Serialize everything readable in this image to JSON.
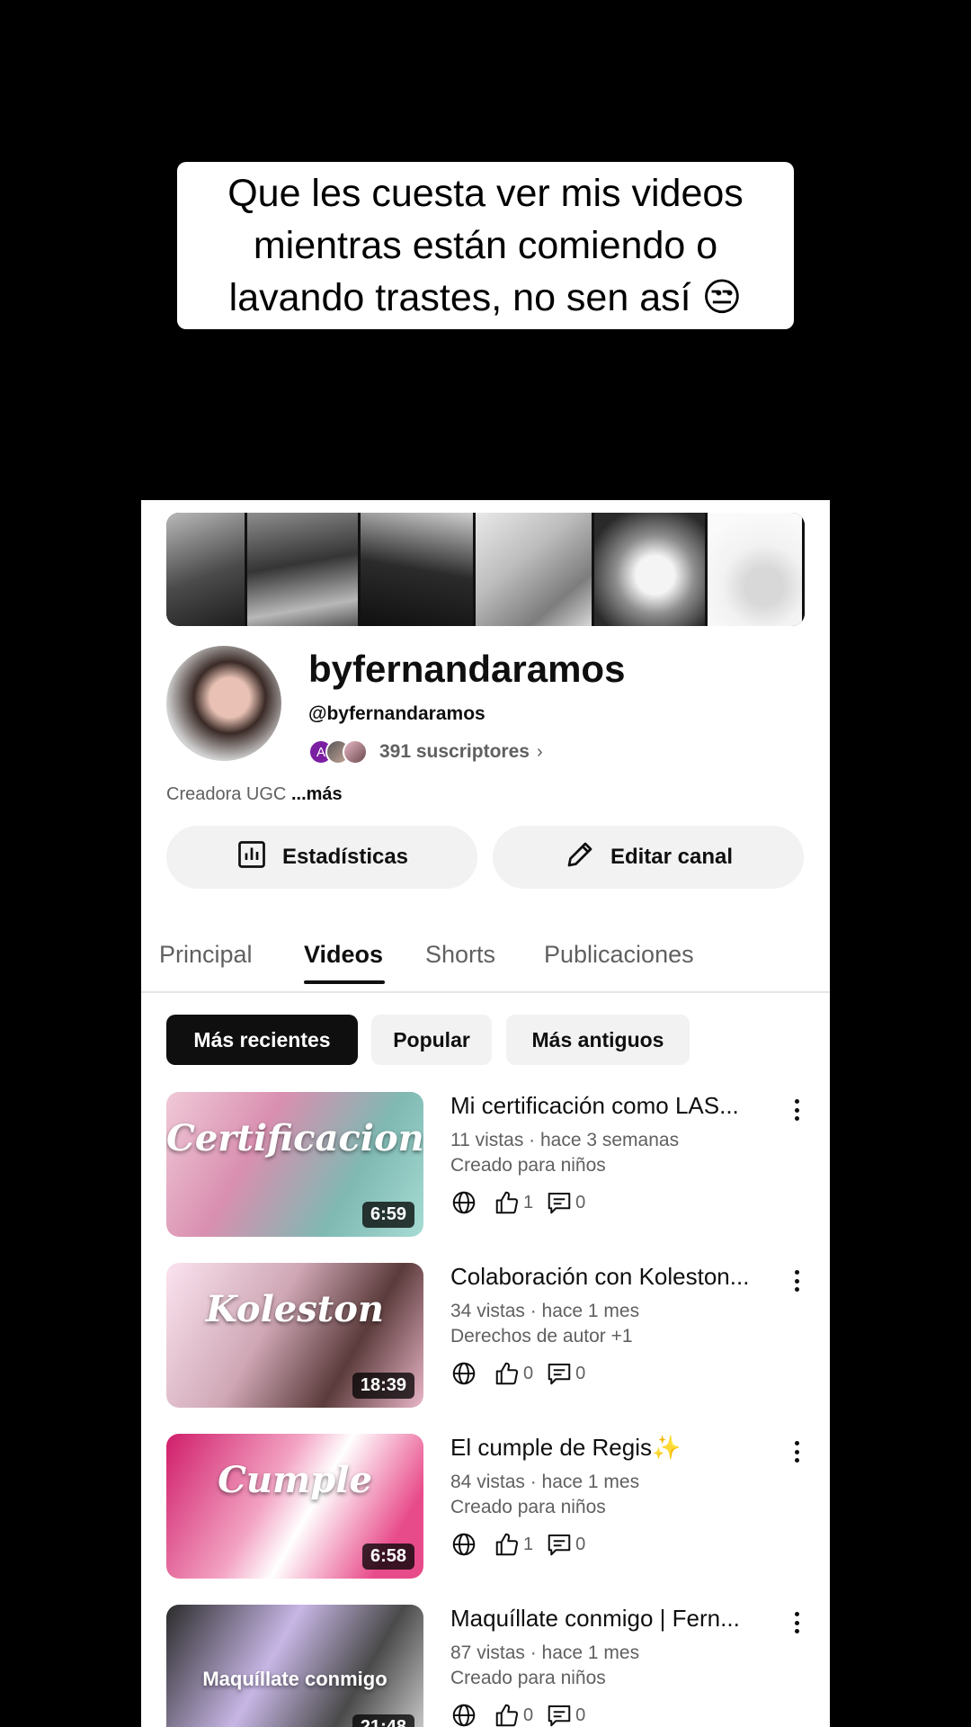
{
  "caption": "Que les cuesta ver mis videos mientras están comiendo o lavando trastes, no sen así 😒",
  "channel": {
    "name": "byfernandaramos",
    "handle": "@byfernandaramos",
    "subscriber_avatar_letter": "A",
    "subscribers": "391 suscriptores",
    "description": "Creadora UGC",
    "more": "...más"
  },
  "buttons": {
    "stats": "Estadísticas",
    "edit": "Editar canal"
  },
  "tabs": [
    "Principal",
    "Videos",
    "Shorts",
    "Publicaciones"
  ],
  "active_tab": "Videos",
  "filters": [
    "Más recientes",
    "Popular",
    "Más antiguos"
  ],
  "active_filter": "Más recientes",
  "videos": [
    {
      "title": "Mi certificación como LAS...",
      "meta": "11 vistas · hace 3 semanas",
      "audience": "Creado para niños",
      "likes": "1",
      "comments": "0",
      "duration": "6:59",
      "thumb_text": "Certificacion"
    },
    {
      "title": "Colaboración con Koleston...",
      "meta": "34 vistas · hace 1 mes",
      "audience": "Derechos de autor +1",
      "likes": "0",
      "comments": "0",
      "duration": "18:39",
      "thumb_text": "Koleston"
    },
    {
      "title": "El cumple de Regis✨",
      "meta": "84 vistas · hace 1 mes",
      "audience": "Creado para niños",
      "likes": "1",
      "comments": "0",
      "duration": "6:58",
      "thumb_text": "Cumple"
    },
    {
      "title": "Maquíllate conmigo | Fern...",
      "meta": "87 vistas · hace 1 mes",
      "audience": "Creado para niños",
      "likes": "0",
      "comments": "0",
      "duration": "21:48",
      "thumb_text": "Maquíllate conmigo"
    }
  ]
}
